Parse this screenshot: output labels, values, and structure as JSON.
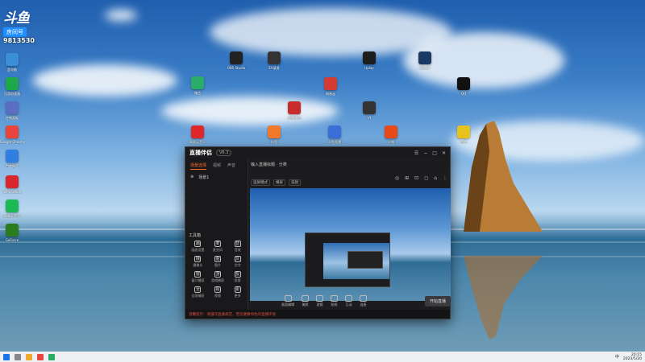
{
  "watermark": {
    "logo": "斗鱼",
    "room_tag": "房间号",
    "room_number": "9813530"
  },
  "desktop_icons": [
    {
      "name": "this-pc",
      "label": "此电脑",
      "color": "#3a8fd8"
    },
    {
      "name": "app-green",
      "label": "迅游加速器",
      "color": "#1fa84a"
    },
    {
      "name": "control-panel",
      "label": "控制面板",
      "color": "#5a6fc2"
    },
    {
      "name": "chrome",
      "label": "Google Chrome",
      "color": "#e8453c"
    },
    {
      "name": "app-blue",
      "label": "百度网盘",
      "color": "#2f7fe0"
    },
    {
      "name": "wps",
      "label": "WPS Office",
      "color": "#d8262e"
    },
    {
      "name": "app-spotify",
      "label": "网易云音乐",
      "color": "#1db954"
    },
    {
      "name": "nvidia",
      "label": "GeForce",
      "color": "#2a7d1e"
    },
    {
      "name": "app-dark1",
      "label": "OBS Studio",
      "color": "#222222"
    },
    {
      "name": "app-eye",
      "label": "EV录屏",
      "color": "#333333"
    },
    {
      "name": "wechat",
      "label": "微信",
      "color": "#2aae67"
    },
    {
      "name": "app-netease",
      "label": "网易云",
      "color": "#d43c33"
    },
    {
      "name": "app-dark2",
      "label": "Uplay",
      "color": "#1d1d1d"
    },
    {
      "name": "steam",
      "label": "Steam",
      "color": "#1b3a63"
    },
    {
      "name": "qq",
      "label": "QQ",
      "color": "#111111"
    },
    {
      "name": "app-red",
      "label": "直播伴侣",
      "color": "#c72b2b"
    },
    {
      "name": "app-vi",
      "label": "VI",
      "color": "#333333"
    },
    {
      "name": "app-tv",
      "label": "斗鱼直播",
      "color": "#3a6fd8"
    },
    {
      "name": "app-orange",
      "label": "抖音",
      "color": "#f07a2a"
    },
    {
      "name": "app-fire",
      "label": "火绒",
      "color": "#e84a1a"
    },
    {
      "name": "app-netease2",
      "label": "网易云音乐",
      "color": "#e0282a"
    },
    {
      "name": "app-yellow",
      "label": "百度",
      "color": "#e7c21c"
    }
  ],
  "app": {
    "brand": "直播伴侣",
    "version": "V6.3",
    "window_buttons": [
      "☰",
      "−",
      "□",
      "✕"
    ],
    "tabs": [
      "场景选择",
      "视频",
      "声音"
    ],
    "scene_row": [
      "⊕",
      "场景1"
    ],
    "tools_heading": "工具箱",
    "tools": [
      {
        "icon": "画",
        "label": "画面设置"
      },
      {
        "icon": "麦",
        "label": "麦克风"
      },
      {
        "icon": "音",
        "label": "音效"
      },
      {
        "icon": "摄",
        "label": "摄像头"
      },
      {
        "icon": "图",
        "label": "图片"
      },
      {
        "icon": "文",
        "label": "文字"
      },
      {
        "icon": "窗",
        "label": "窗口捕获"
      },
      {
        "icon": "游",
        "label": "游戏捕获"
      },
      {
        "icon": "投",
        "label": "投屏"
      },
      {
        "icon": "全",
        "label": "全屏捕获"
      },
      {
        "icon": "视",
        "label": "视频"
      },
      {
        "icon": "更",
        "label": "更多"
      }
    ],
    "notice": "温馨提示：请遵守直播规范，营造健康绿色的直播环境",
    "stream_info": "输入直播标题 · 分类",
    "top_icons": [
      "◎",
      "⊞",
      "⊡",
      "◻",
      "⌂",
      "⋮"
    ],
    "sub_tabs": [
      "竖屏模式",
      "横屏",
      "美颜"
    ],
    "bottom_tools": [
      "画面编辑",
      "美颜",
      "滤镜",
      "贴纸",
      "互动",
      "连麦"
    ],
    "go_live_label": "开始直播"
  },
  "taskbar": {
    "time": "20:15",
    "date": "2023/5/20",
    "lang": "中"
  }
}
